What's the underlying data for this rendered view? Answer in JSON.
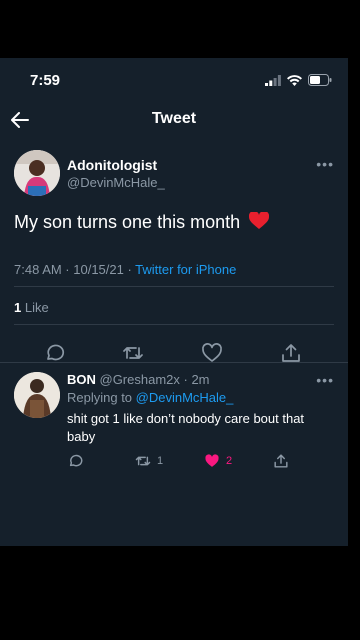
{
  "status_bar": {
    "time": "7:59"
  },
  "nav": {
    "title": "Tweet"
  },
  "tweet": {
    "author_name": "Adonitologist",
    "author_handle": "@DevinMcHale_",
    "text": "My son turns one this month",
    "timestamp": "7:48 AM · 10/15/21 · ",
    "source": "Twitter for iPhone",
    "like_count": "1",
    "like_label": " Like"
  },
  "reply": {
    "author_name": "BON",
    "author_meta": " @Gresham2x · 2m",
    "replying_prefix": "Replying to ",
    "replying_to": "@DevinMcHale_",
    "text": "shit got 1 like don’t nobody care bout that baby",
    "retweet_count": "1",
    "like_count": "2"
  },
  "colors": {
    "background": "#15202b",
    "link": "#1d9bf0",
    "like": "#f91880",
    "muted": "#8b98a5"
  }
}
